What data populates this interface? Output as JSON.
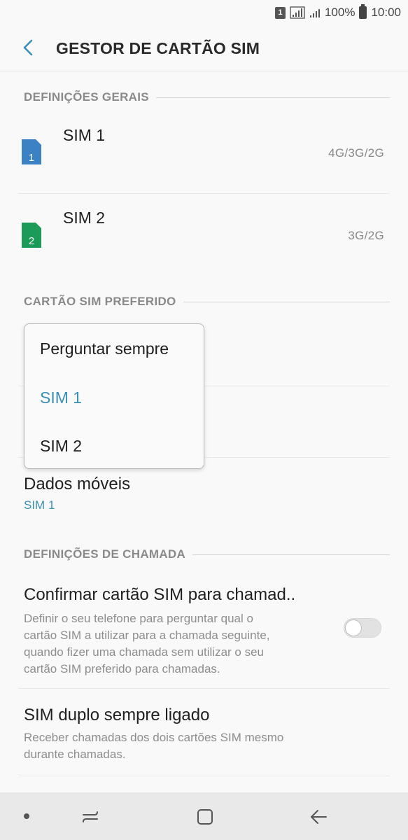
{
  "status_bar": {
    "sim_badge": "1",
    "battery": "100%",
    "time": "10:00"
  },
  "app_bar": {
    "title": "GESTOR DE CARTÃO SIM"
  },
  "general": {
    "header": "DEFINIÇÕES GERAIS",
    "sims": [
      {
        "name": "SIM 1",
        "network": "4G/3G/2G",
        "badge": "1",
        "color": "#3b82c4"
      },
      {
        "name": "SIM 2",
        "network": "3G/2G",
        "badge": "2",
        "color": "#1c9a58"
      }
    ]
  },
  "preferred": {
    "header": "CARTÃO SIM PREFERIDO",
    "mobile_data": {
      "title": "Dados móveis",
      "value": "SIM 1"
    }
  },
  "dropdown": {
    "options": [
      "Perguntar sempre",
      "SIM 1",
      "SIM 2"
    ],
    "selected": "SIM 1"
  },
  "calls": {
    "header": "DEFINIÇÕES DE CHAMADA",
    "confirm": {
      "title": "Confirmar cartão SIM para chamad..",
      "desc_lines": [
        "Definir o seu telefone para perguntar qual o",
        "cartão SIM a utilizar para a chamada seguinte,",
        "quando fizer uma chamada sem utilizar o seu",
        "cartão SIM preferido para chamadas."
      ],
      "enabled": false
    },
    "dual": {
      "title": "SIM duplo sempre ligado",
      "desc_lines": [
        "Receber chamadas dos dois cartões SIM mesmo",
        "durante chamadas."
      ]
    }
  },
  "colors": {
    "accent": "#3a8fb7",
    "background": "#f9f9f9",
    "nav_bar": "#e9e9e9"
  }
}
